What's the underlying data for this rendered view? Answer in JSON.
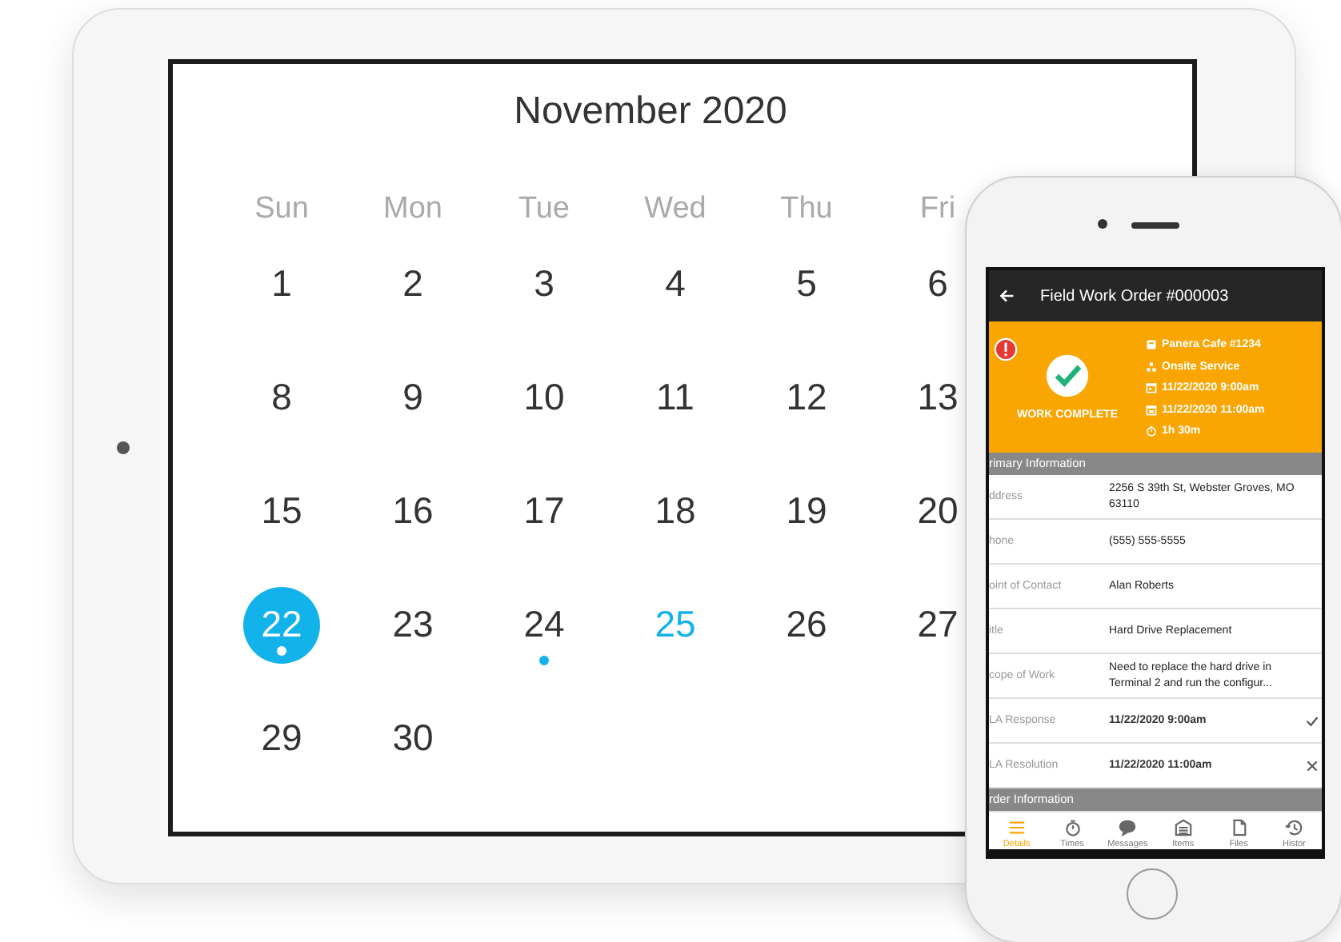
{
  "calendar": {
    "title": "November 2020",
    "weekdays": [
      "Sun",
      "Mon",
      "Tue",
      "Wed",
      "Thu",
      "Fri"
    ],
    "weeks": [
      [
        {
          "day": "1",
          "selected": false,
          "today": false,
          "has_event": false
        },
        {
          "day": "2",
          "selected": false,
          "today": false,
          "has_event": false
        },
        {
          "day": "3",
          "selected": false,
          "today": false,
          "has_event": false
        },
        {
          "day": "4",
          "selected": false,
          "today": false,
          "has_event": false
        },
        {
          "day": "5",
          "selected": false,
          "today": false,
          "has_event": false
        },
        {
          "day": "6",
          "selected": false,
          "today": false,
          "has_event": false
        }
      ],
      [
        {
          "day": "8",
          "selected": false,
          "today": false,
          "has_event": false
        },
        {
          "day": "9",
          "selected": false,
          "today": false,
          "has_event": false
        },
        {
          "day": "10",
          "selected": false,
          "today": false,
          "has_event": false
        },
        {
          "day": "11",
          "selected": false,
          "today": false,
          "has_event": false
        },
        {
          "day": "12",
          "selected": false,
          "today": false,
          "has_event": false
        },
        {
          "day": "13",
          "selected": false,
          "today": false,
          "has_event": false
        }
      ],
      [
        {
          "day": "15",
          "selected": false,
          "today": false,
          "has_event": false
        },
        {
          "day": "16",
          "selected": false,
          "today": false,
          "has_event": false
        },
        {
          "day": "17",
          "selected": false,
          "today": false,
          "has_event": false
        },
        {
          "day": "18",
          "selected": false,
          "today": false,
          "has_event": false
        },
        {
          "day": "19",
          "selected": false,
          "today": false,
          "has_event": false
        },
        {
          "day": "20",
          "selected": false,
          "today": false,
          "has_event": false
        }
      ],
      [
        {
          "day": "22",
          "selected": true,
          "today": false,
          "has_event": true
        },
        {
          "day": "23",
          "selected": false,
          "today": false,
          "has_event": false
        },
        {
          "day": "24",
          "selected": false,
          "today": false,
          "has_event": true
        },
        {
          "day": "25",
          "selected": false,
          "today": true,
          "has_event": false
        },
        {
          "day": "26",
          "selected": false,
          "today": false,
          "has_event": false
        },
        {
          "day": "27",
          "selected": false,
          "today": false,
          "has_event": false
        }
      ],
      [
        {
          "day": "29",
          "selected": false,
          "today": false,
          "has_event": false
        },
        {
          "day": "30",
          "selected": false,
          "today": false,
          "has_event": false
        }
      ]
    ]
  },
  "phone": {
    "title": "Field Work Order #000003",
    "status": {
      "label": "WORK COMPLETE",
      "alert": true,
      "details": [
        {
          "kind": "customer",
          "text": "Panera Cafe #1234"
        },
        {
          "kind": "service",
          "text": "Onsite Service"
        },
        {
          "kind": "start",
          "text": "11/22/2020 9:00am"
        },
        {
          "kind": "end",
          "text": "11/22/2020 11:00am"
        },
        {
          "kind": "duration",
          "text": "1h 30m"
        }
      ]
    },
    "sections": [
      {
        "title": "rimary Information",
        "rows": [
          {
            "label": "ddress",
            "value": "2256 S 39th St, Webster Groves, MO 63110",
            "bold": false
          },
          {
            "label": "hone",
            "value": "(555) 555-5555",
            "bold": false
          },
          {
            "label": "oint of Contact",
            "value": "Alan Roberts",
            "bold": false
          },
          {
            "label": "itle",
            "value": "Hard Drive Replacement",
            "bold": false
          },
          {
            "label": "cope of Work",
            "value": "Need to replace the hard drive in Terminal 2 and run the configur...",
            "bold": false
          },
          {
            "label": "LA Response",
            "value": "11/22/2020 9:00am",
            "bold": true,
            "met": true
          },
          {
            "label": "LA Resolution",
            "value": "11/22/2020 11:00am",
            "bold": true,
            "met": false
          }
        ]
      },
      {
        "title": "rder Information"
      }
    ],
    "tabs": [
      {
        "kind": "list",
        "label": "Details",
        "selected": true
      },
      {
        "kind": "timer",
        "label": "Times",
        "selected": false
      },
      {
        "kind": "chat",
        "label": "Messages",
        "selected": false
      },
      {
        "kind": "store",
        "label": "Items",
        "selected": false
      },
      {
        "kind": "file",
        "label": "Files",
        "selected": false
      },
      {
        "kind": "history",
        "label": "Histor",
        "selected": false
      }
    ]
  }
}
